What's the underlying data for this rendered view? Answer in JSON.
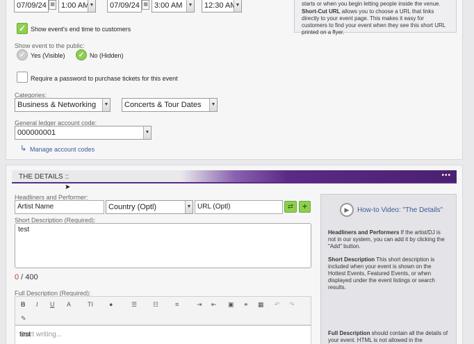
{
  "dates": {
    "start_date": "07/09/24",
    "start_time": "1:00 AM",
    "end_date": "07/09/24",
    "end_time": "3:00 AM",
    "doors_time": "12:30 AM"
  },
  "show_end_time_label": "Show event's end time to customers",
  "public": {
    "label": "Show event to the public:",
    "yes_label": "Yes (Visible)",
    "no_label": "No (Hidden)"
  },
  "password_label": "Require a password to purchase tickets for this event",
  "categories": {
    "label": "Categories:",
    "primary": "Business & Networking",
    "secondary": "Concerts & Tour Dates"
  },
  "ledger": {
    "label": "General ledger account code:",
    "value": "000000001",
    "manage_link": "Manage account codes"
  },
  "help_top": {
    "line1": "starts or when you begin letting people inside the venue.",
    "shortcut_title": "Short-Cut URL",
    "shortcut_text": " allows you to choose a URL that links directly to your event page. This makes it easy for customers to find your event when they see this short URL printed on a flyer."
  },
  "details": {
    "header": "THE DETAILS ::",
    "headliners_label": "Headliners and Performer:",
    "artist_value": "Artist Name",
    "country_value": "Country (Optl)",
    "url_value": "URL (Optl)",
    "short_desc_label": "Short Description (Required):",
    "short_desc_value": "test",
    "counter_used": "0",
    "counter_total": " / 400",
    "full_desc_label": "Full Description (Required):",
    "editor_placeholder": "Start writing...",
    "editor_value": "test"
  },
  "toolbar": {
    "bold": "B",
    "italic": "I",
    "underline": "U",
    "font_color": "A",
    "font_size": "TI",
    "highlight": "●",
    "bullets": "☰",
    "numbers": "☷",
    "align": "≡",
    "indent": "⇥",
    "outdent": "⇤",
    "image": "▣",
    "link": "⚭",
    "table": "▦",
    "undo": "↶",
    "redo": "↷",
    "eraser": "✎"
  },
  "help_side": {
    "video_title": "How-to Video: \"The Details\"",
    "headliners_title": "Headliners and Performers",
    "headliners_text": " If the artist/DJ is not in our system, you can add it by clicking the \"Add\" button.",
    "short_title": "Short Description",
    "short_text": " This short description is included when your event is shown on the Hottest Events, Featured Events, or when displayed under the event listings or search results.",
    "full_title": "Full Description",
    "full_text": " should contain all the details of your event. HTML is not allowed in the description, however you are able to apply rich"
  },
  "colors": {
    "accent_purple": "#5b2a86",
    "check_green": "#8fcf4f",
    "link_blue": "#3b5a9a"
  }
}
